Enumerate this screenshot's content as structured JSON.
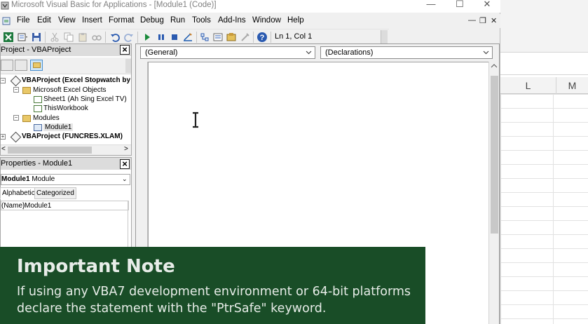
{
  "window": {
    "title": "Microsoft Visual Basic for Applications - [Module1 (Code)]",
    "minimize": "—",
    "maximize": "☐",
    "close": "✕"
  },
  "menu": {
    "items": [
      "File",
      "Edit",
      "View",
      "Insert",
      "Format",
      "Debug",
      "Run",
      "Tools",
      "Add-Ins",
      "Window",
      "Help"
    ],
    "mdi_minimize": "—",
    "mdi_restore": "❐",
    "mdi_close": "✕"
  },
  "toolbar": {
    "position": "Ln 1, Col 1",
    "icons": [
      "excel-view-icon",
      "insert-module-icon",
      "save-icon",
      "cut-icon",
      "copy-icon",
      "paste-icon",
      "find-icon",
      "undo-icon",
      "redo-icon",
      "run-icon",
      "break-icon",
      "reset-icon",
      "design-mode-icon",
      "project-explorer-icon",
      "properties-icon",
      "object-browser-icon",
      "toolbox-icon",
      "help-icon"
    ]
  },
  "project_pane": {
    "title": "Project - VBAProject",
    "tree": {
      "project1": "VBAProject (Excel Stopwatch by",
      "excel_objects": "Microsoft Excel Objects",
      "sheet1": "Sheet1 (Ah Sing Excel TV)",
      "this_workbook": "ThisWorkbook",
      "modules": "Modules",
      "module1": "Module1",
      "project2": "VBAProject (FUNCRES.XLAM)"
    },
    "scroll_left": "<",
    "scroll_right": ">"
  },
  "properties_pane": {
    "title": "Properties - Module1",
    "object_name": "Module1",
    "object_type": "Module",
    "tabs": [
      "Alphabetic",
      "Categorized"
    ],
    "rows": [
      {
        "name": "(Name)",
        "value": "Module1"
      }
    ]
  },
  "code_window": {
    "object_combo": "(General)",
    "procedure_combo": "(Declarations)"
  },
  "excel": {
    "columns": [
      "L",
      "M"
    ]
  },
  "note": {
    "title": "Important Note",
    "body": "If using any VBA7 development environment or 64-bit platforms declare the statement with the \"PtrSafe\" keyword."
  },
  "colors": {
    "banner_green": "#194d27",
    "toolbar_bg": "#f0f0f0"
  }
}
